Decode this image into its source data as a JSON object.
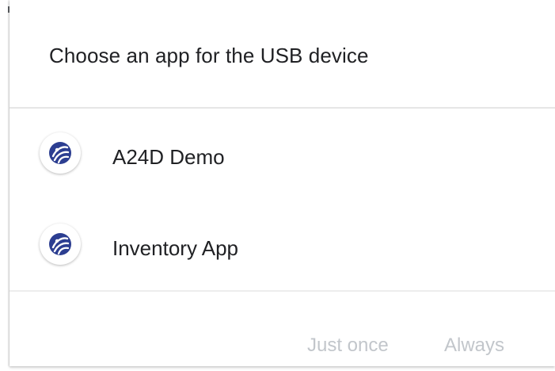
{
  "dialog": {
    "title": "Choose an app for the USB device",
    "apps": [
      {
        "label": "A24D Demo",
        "icon": "app-logo-icon"
      },
      {
        "label": "Inventory App",
        "icon": "app-logo-icon"
      }
    ],
    "actions": {
      "just_once": "Just once",
      "always": "Always"
    }
  },
  "colors": {
    "icon_primary": "#2c3e91",
    "disabled_text": "#c2c6cb",
    "divider": "#e6e6e6"
  }
}
